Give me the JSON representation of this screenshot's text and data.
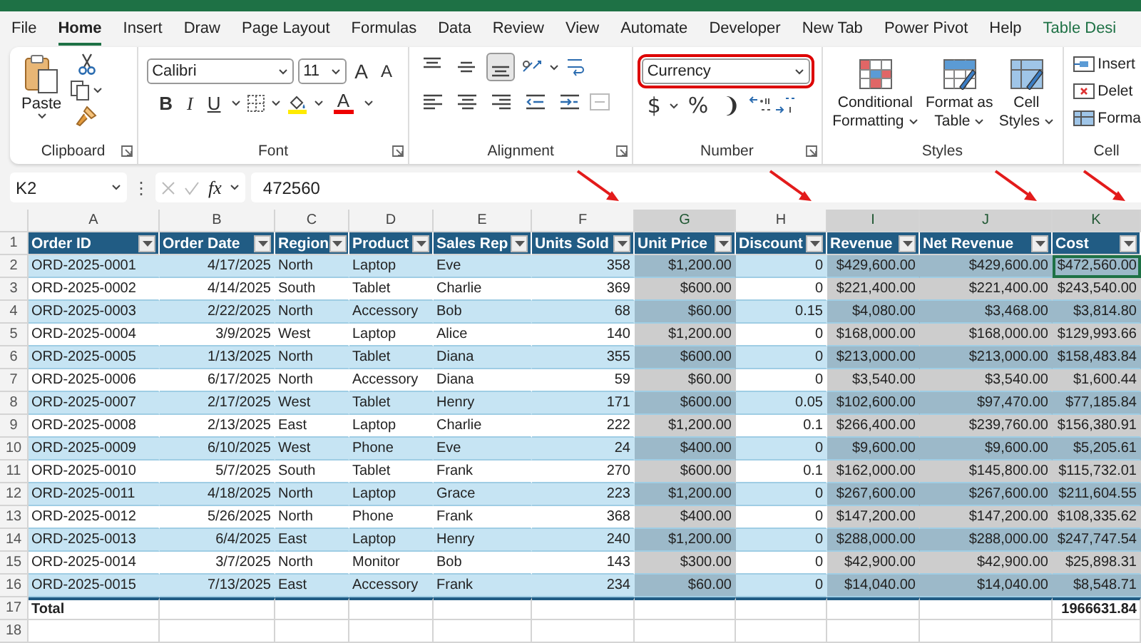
{
  "tabs": [
    {
      "label": "File",
      "selected": false,
      "kind": "normal"
    },
    {
      "label": "Home",
      "selected": true,
      "kind": "normal"
    },
    {
      "label": "Insert",
      "selected": false,
      "kind": "normal"
    },
    {
      "label": "Draw",
      "selected": false,
      "kind": "normal"
    },
    {
      "label": "Page Layout",
      "selected": false,
      "kind": "normal"
    },
    {
      "label": "Formulas",
      "selected": false,
      "kind": "normal"
    },
    {
      "label": "Data",
      "selected": false,
      "kind": "normal"
    },
    {
      "label": "Review",
      "selected": false,
      "kind": "normal"
    },
    {
      "label": "View",
      "selected": false,
      "kind": "normal"
    },
    {
      "label": "Automate",
      "selected": false,
      "kind": "normal"
    },
    {
      "label": "Developer",
      "selected": false,
      "kind": "normal"
    },
    {
      "label": "New Tab",
      "selected": false,
      "kind": "normal"
    },
    {
      "label": "Power Pivot",
      "selected": false,
      "kind": "normal"
    },
    {
      "label": "Help",
      "selected": false,
      "kind": "normal"
    },
    {
      "label": "Table Desi",
      "selected": false,
      "kind": "contextual"
    }
  ],
  "clipboard": {
    "paste": "Paste",
    "label": "Clipboard"
  },
  "font": {
    "family": "Calibri",
    "size": "11",
    "grow": "A",
    "shrink": "A",
    "bold": "B",
    "italic": "I",
    "underline": "U",
    "font_color_letter": "A",
    "label": "Font"
  },
  "alignment": {
    "label": "Alignment",
    "top_row": [
      {
        "kind": "top",
        "selected": false
      },
      {
        "kind": "middle",
        "selected": false
      },
      {
        "kind": "bottom",
        "selected": true
      }
    ],
    "bottom_row": [
      {
        "kind": "left",
        "selected": false
      },
      {
        "kind": "center",
        "selected": false
      },
      {
        "kind": "right",
        "selected": false
      },
      {
        "kind": "outdent",
        "selected": false
      },
      {
        "kind": "indent",
        "selected": false
      }
    ]
  },
  "number": {
    "format": "Currency",
    "highlighted": true,
    "currency": "$",
    "percent": "%",
    "comma": "❩",
    "label": "Number"
  },
  "styles": {
    "label": "Styles",
    "buttons": [
      {
        "label": "Conditional Formatting",
        "kind": "conditional"
      },
      {
        "label": "Format as Table",
        "kind": "table"
      },
      {
        "label": "Cell Styles",
        "kind": "cellstyles"
      }
    ]
  },
  "cells": {
    "label": "Cell",
    "items": [
      {
        "label": "Insert",
        "kind": "insert"
      },
      {
        "label": "Delet",
        "kind": "delete"
      },
      {
        "label": "Forma",
        "kind": "format"
      }
    ]
  },
  "formula_bar": {
    "name_box": "K2",
    "more": "⋮",
    "fx": "fx",
    "formula": "472560"
  },
  "grid": {
    "header_row": "1",
    "columns": [
      {
        "letter": "A",
        "header": "Order ID",
        "selected": false,
        "arrow": false
      },
      {
        "letter": "B",
        "header": "Order Date",
        "selected": false,
        "arrow": false
      },
      {
        "letter": "C",
        "header": "Region",
        "selected": false,
        "arrow": false
      },
      {
        "letter": "D",
        "header": "Product",
        "selected": false,
        "arrow": false
      },
      {
        "letter": "E",
        "header": "Sales Rep",
        "selected": false,
        "arrow": false
      },
      {
        "letter": "F",
        "header": "Units Sold",
        "selected": false,
        "arrow": true
      },
      {
        "letter": "G",
        "header": "Unit Price",
        "selected": true,
        "arrow": false
      },
      {
        "letter": "H",
        "header": "Discount",
        "selected": false,
        "arrow": true
      },
      {
        "letter": "I",
        "header": "Revenue",
        "selected": true,
        "arrow": false
      },
      {
        "letter": "J",
        "header": "Net Revenue",
        "selected": true,
        "arrow": true
      },
      {
        "letter": "K",
        "header": "Cost",
        "selected": true,
        "arrow": true
      }
    ],
    "rows": [
      {
        "num": "2",
        "cells": [
          "ORD-2025-0001",
          "4/17/2025",
          "North",
          "Laptop",
          "Eve",
          "358",
          "$1,200.00",
          "0",
          "$429,600.00",
          "$429,600.00",
          "$472,560.00"
        ]
      },
      {
        "num": "3",
        "cells": [
          "ORD-2025-0002",
          "4/14/2025",
          "South",
          "Tablet",
          "Charlie",
          "369",
          "$600.00",
          "0",
          "$221,400.00",
          "$221,400.00",
          "$243,540.00"
        ]
      },
      {
        "num": "4",
        "cells": [
          "ORD-2025-0003",
          "2/22/2025",
          "North",
          "Accessory",
          "Bob",
          "68",
          "$60.00",
          "0.15",
          "$4,080.00",
          "$3,468.00",
          "$3,814.80"
        ]
      },
      {
        "num": "5",
        "cells": [
          "ORD-2025-0004",
          "3/9/2025",
          "West",
          "Laptop",
          "Alice",
          "140",
          "$1,200.00",
          "0",
          "$168,000.00",
          "$168,000.00",
          "$129,993.66"
        ]
      },
      {
        "num": "6",
        "cells": [
          "ORD-2025-0005",
          "1/13/2025",
          "North",
          "Tablet",
          "Diana",
          "355",
          "$600.00",
          "0",
          "$213,000.00",
          "$213,000.00",
          "$158,483.84"
        ]
      },
      {
        "num": "7",
        "cells": [
          "ORD-2025-0006",
          "6/17/2025",
          "North",
          "Accessory",
          "Diana",
          "59",
          "$60.00",
          "0",
          "$3,540.00",
          "$3,540.00",
          "$1,600.44"
        ]
      },
      {
        "num": "8",
        "cells": [
          "ORD-2025-0007",
          "2/17/2025",
          "West",
          "Tablet",
          "Henry",
          "171",
          "$600.00",
          "0.05",
          "$102,600.00",
          "$97,470.00",
          "$77,185.84"
        ]
      },
      {
        "num": "9",
        "cells": [
          "ORD-2025-0008",
          "2/13/2025",
          "East",
          "Laptop",
          "Charlie",
          "222",
          "$1,200.00",
          "0.1",
          "$266,400.00",
          "$239,760.00",
          "$156,380.91"
        ]
      },
      {
        "num": "10",
        "cells": [
          "ORD-2025-0009",
          "6/10/2025",
          "West",
          "Phone",
          "Eve",
          "24",
          "$400.00",
          "0",
          "$9,600.00",
          "$9,600.00",
          "$5,205.61"
        ]
      },
      {
        "num": "11",
        "cells": [
          "ORD-2025-0010",
          "5/7/2025",
          "South",
          "Tablet",
          "Frank",
          "270",
          "$600.00",
          "0.1",
          "$162,000.00",
          "$145,800.00",
          "$115,732.01"
        ]
      },
      {
        "num": "12",
        "cells": [
          "ORD-2025-0011",
          "4/18/2025",
          "North",
          "Laptop",
          "Grace",
          "223",
          "$1,200.00",
          "0",
          "$267,600.00",
          "$267,600.00",
          "$211,604.55"
        ]
      },
      {
        "num": "13",
        "cells": [
          "ORD-2025-0012",
          "5/26/2025",
          "North",
          "Phone",
          "Frank",
          "368",
          "$400.00",
          "0",
          "$147,200.00",
          "$147,200.00",
          "$108,335.62"
        ]
      },
      {
        "num": "14",
        "cells": [
          "ORD-2025-0013",
          "6/4/2025",
          "East",
          "Laptop",
          "Henry",
          "240",
          "$1,200.00",
          "0",
          "$288,000.00",
          "$288,000.00",
          "$247,747.54"
        ]
      },
      {
        "num": "15",
        "cells": [
          "ORD-2025-0014",
          "3/7/2025",
          "North",
          "Monitor",
          "Bob",
          "143",
          "$300.00",
          "0",
          "$42,900.00",
          "$42,900.00",
          "$25,898.31"
        ]
      },
      {
        "num": "16",
        "cells": [
          "ORD-2025-0015",
          "7/13/2025",
          "East",
          "Accessory",
          "Frank",
          "234",
          "$60.00",
          "0",
          "$14,040.00",
          "$14,040.00",
          "$8,548.71"
        ]
      }
    ],
    "total": {
      "num": "17",
      "label": "Total",
      "value": "1966631.84"
    },
    "empty_row": "18"
  }
}
